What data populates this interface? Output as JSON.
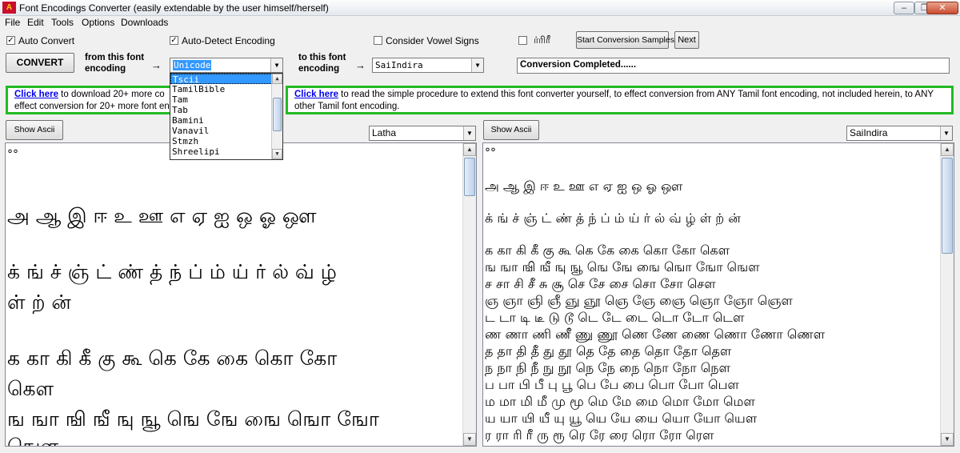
{
  "window": {
    "icon_text": "A",
    "title": "Font Encodings Converter (easily extendable by the user himself/herself)",
    "minimize_glyph": "–",
    "maximize_glyph": "❐",
    "close_glyph": "✕"
  },
  "menu": [
    "File",
    "Edit",
    "Tools",
    "Options",
    "Downloads"
  ],
  "options": {
    "auto_convert": {
      "label": "Auto Convert",
      "checked": true
    },
    "auto_detect": {
      "label": "Auto-Detect Encoding",
      "checked": true
    },
    "vowel_signs": {
      "label": "Consider Vowel Signs",
      "checked": false
    },
    "tamil_sample": {
      "label": "ர்ரிரீ",
      "checked": false
    }
  },
  "buttons": {
    "start_samples": "Start Conversion Samples",
    "next": "Next",
    "convert": "CONVERT",
    "show_ascii": "Show Ascii"
  },
  "from": {
    "label_line1": "from this font",
    "label_line2": "encoding",
    "arrow": "→",
    "value": "Unicode"
  },
  "to": {
    "label_line1": "to this font",
    "label_line2": "encoding",
    "arrow": "→",
    "value": "SaiIndira"
  },
  "status": "Conversion Completed......",
  "dropdown": {
    "items": [
      "Tscii",
      "TamilBible",
      "Tam",
      "Tab",
      "Bamini",
      "Vanavil",
      "Stmzh",
      "Shreelipi"
    ],
    "selected_index": 0
  },
  "info": {
    "left_link": "Click here",
    "left_text_1": " to download 20+ more co",
    "left_text_2": "effect conversion for 20+ more font enc",
    "right_link": "Click here",
    "right_text_1": " to read the simple procedure to extend this font converter yourself, to effect conversion from ANY Tamil font encoding, not included herein, to ANY",
    "right_text_2": "other Tamil font encoding."
  },
  "left_pane": {
    "font": "Latha",
    "lines": [
      "°°",
      "அ ஆ இ ஈ உ ஊ எ ஏ ஐ ஒ ஓ ஔ",
      "க் ங் ச் ஞ் ட் ண் த் ந் ப் ம் ய் ர் ல் வ் ழ்",
      "ள் ற் ன்",
      "க கா கி கீ கு கூ கெ கே கை கொ கோ",
      "கௌ",
      "ங ஙா ஙி ஙீ ஙு ஙூ ஙெ ஙே ஙை ஙொ ஙோ",
      "ஙௌ"
    ]
  },
  "right_pane": {
    "font": "SaiIndira",
    "lines": [
      "°°",
      "அ ஆ இ ஈ உ ஊ எ ஏ ஐ ஒ ஓ ஔ",
      "க் ங் ச் ஞ் ட் ண் த் ந் ப் ம் ய் ர் ல் வ் ழ் ள் ற் ன்",
      "க கா கி கீ கு கூ கெ கே கை கொ கோ கௌ",
      "ங ஙா ஙி ஙீ ஙு ஙூ ஙெ ஙே ஙை ஙொ ஙோ ஙௌ",
      "ச சா சி சீ சு சூ செ சே சை சொ சோ சௌ",
      "ஞ ஞா ஞி ஞீ ஞு ஞூ ஞெ ஞே ஞை ஞொ ஞோ ஞௌ",
      "ட டா டி டீ டு டூ டெ டே டை டொ டோ டௌ",
      "ண ணா ணி ணீ ணு ணூ ணெ ணே ணை ணொ ணோ ணௌ",
      "த தா தி தீ து தூ தெ தே தை தொ தோ தௌ",
      "ந நா நி நீ நு நூ நெ நே நை நொ நோ நௌ",
      "ப பா பி பீ பு பூ பெ பே பை பொ போ பௌ",
      "ம மா மி மீ மு மூ மெ மே மை மொ மோ மௌ",
      "ய யா யி யீ யு யூ யெ யே யை யொ யோ யௌ",
      "ர ரா ரி ரீ ரு ரூ ரெ ரே ரை ரொ ரோ ரௌ"
    ]
  },
  "icons": {
    "check": "✓",
    "dropdown_arrow": "▼",
    "scroll_up": "▲",
    "scroll_down": "▼"
  }
}
